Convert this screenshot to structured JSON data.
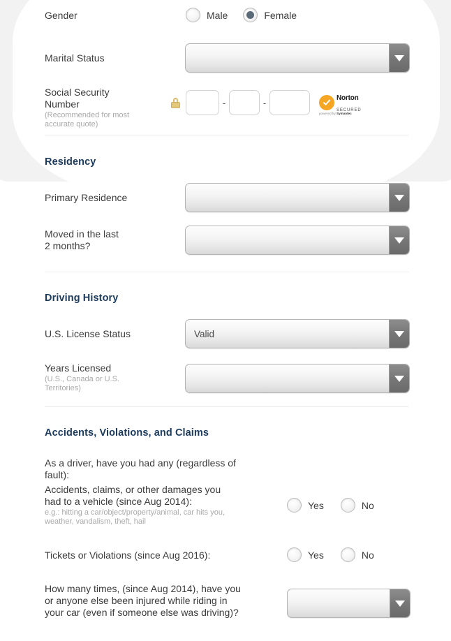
{
  "form": {
    "gender": {
      "label": "Gender",
      "options": [
        {
          "label": "Male",
          "selected": false
        },
        {
          "label": "Female",
          "selected": true
        }
      ]
    },
    "marital_status": {
      "label": "Marital Status",
      "value": ""
    },
    "ssn": {
      "label": "Social Security Number",
      "hint": "(Recommended for most accurate quote)",
      "part1": "",
      "part2": "",
      "part3": "",
      "separator": "-",
      "lock_icon": "lock-icon",
      "badge": {
        "name": "Norton",
        "secured": "SECURED",
        "powered_prefix": "powered by ",
        "powered_brand": "Symantec"
      }
    }
  },
  "residency": {
    "heading": "Residency",
    "primary_residence": {
      "label": "Primary Residence",
      "value": ""
    },
    "moved": {
      "label": "Moved in the last 2 months?",
      "value": ""
    }
  },
  "driving_history": {
    "heading": "Driving History",
    "license_status": {
      "label": "U.S. License Status",
      "value": "Valid"
    },
    "years_licensed": {
      "label": "Years Licensed",
      "hint": "(U.S., Canada or U.S. Territories)",
      "value": ""
    }
  },
  "accidents": {
    "heading": "Accidents, Violations, and Claims",
    "intro": "As a driver, have you had any (regardless of fault):",
    "accidents_q": {
      "label": "Accidents, claims, or other damages you had to a vehicle (since Aug 2014):",
      "hint": "e.g.: hitting a car/object/property/animal, car hits you, weather, vandalism, theft, hail",
      "yes": "Yes",
      "no": "No",
      "selected": ""
    },
    "tickets_q": {
      "label": "Tickets or Violations (since Aug 2016):",
      "yes": "Yes",
      "no": "No",
      "selected": ""
    },
    "injured_q": {
      "label": "How many times, (since Aug 2014), have you or anyone else been injured while riding in your car (even if someone else was driving)?",
      "value": ""
    }
  },
  "colors": {
    "heading": "#1b3a5c",
    "label": "#3b3b3b",
    "hint": "#a9a9a9",
    "radio_selected": "#5b6a78",
    "badge_orange": "#f5a623"
  }
}
